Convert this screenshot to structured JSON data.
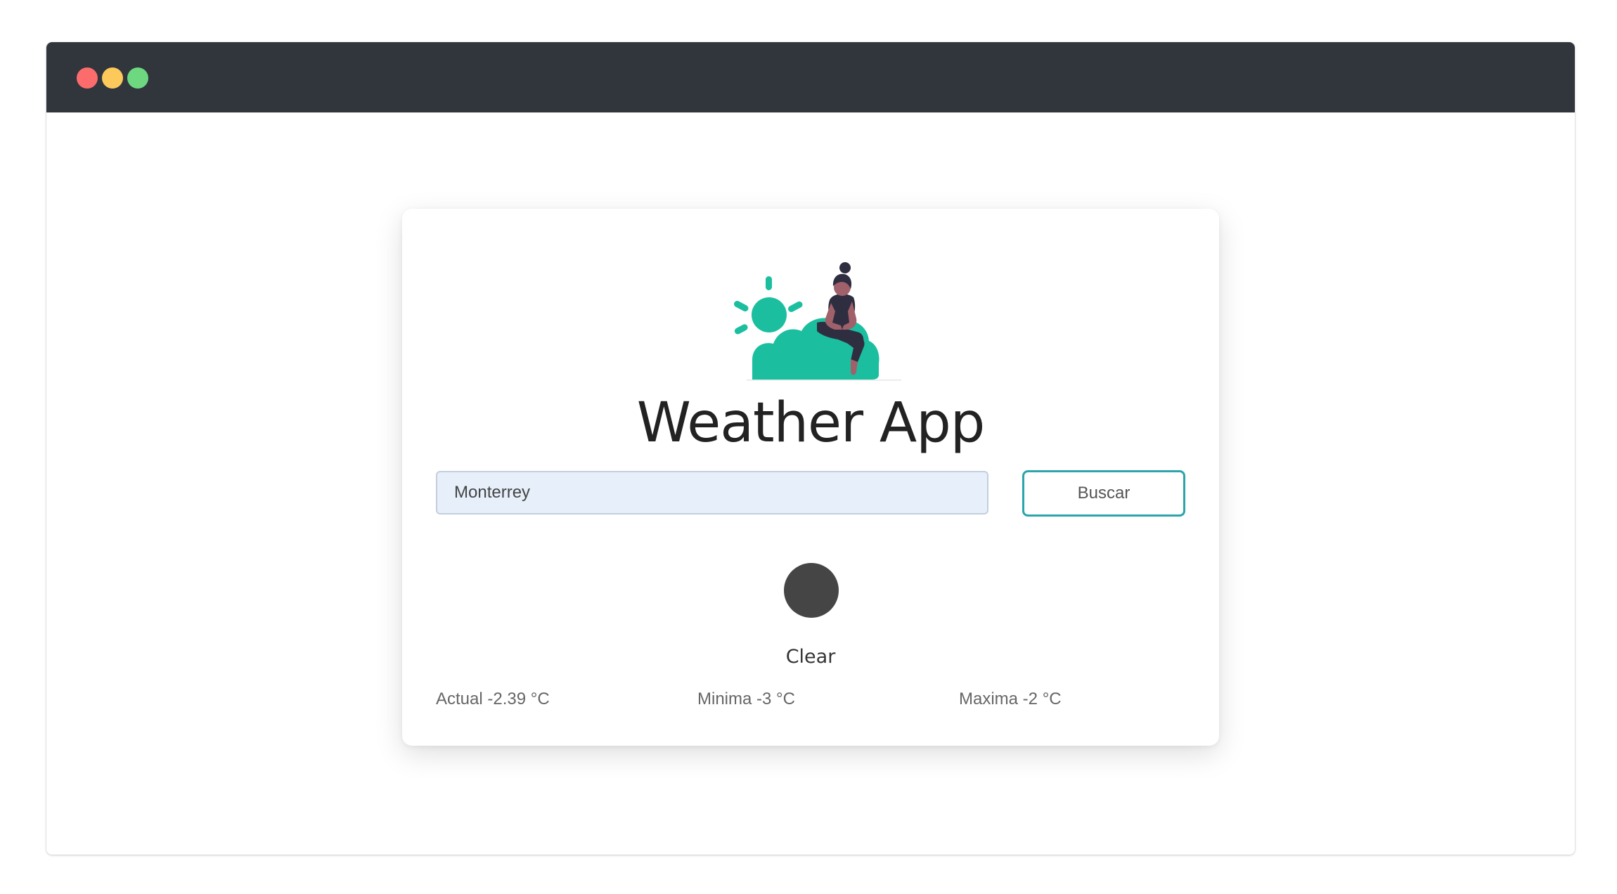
{
  "window": {
    "buttons": [
      {
        "name": "close",
        "color": "#fc6c6c"
      },
      {
        "name": "minimize",
        "color": "#fdc95b"
      },
      {
        "name": "maximize",
        "color": "#6dd87f"
      }
    ]
  },
  "app": {
    "title": "Weather App",
    "illustration_icon": "sun-cloud-woman-illustration",
    "accent_color": "#1bbf9f"
  },
  "search": {
    "value": "Monterrey",
    "button_label": "Buscar"
  },
  "weather": {
    "icon": "weather-condition-icon",
    "condition": "Clear",
    "actual": "Actual -2.39 °C",
    "minima": "Minima -3 °C",
    "maxima": "Maxima -2 °C"
  }
}
